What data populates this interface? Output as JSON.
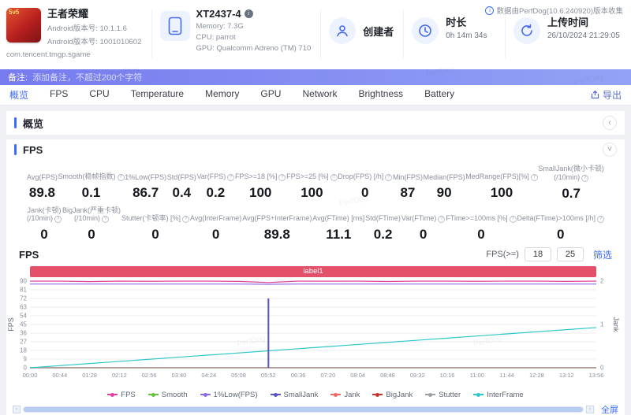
{
  "watermark": "PerfDog",
  "header": {
    "game": {
      "icon_text": "5v5",
      "name": "王者荣耀",
      "android_version": "Android版本号: 10.1.1.6",
      "android_build": "Android版本号: 1001010602",
      "package": "com.tencent.tmgp.sgame"
    },
    "device": {
      "model": "XT2437-4",
      "memory": "Memory: 7.3G",
      "cpu": "CPU: parrot",
      "gpu": "GPU: Qualcomm Adreno (TM) 710"
    },
    "creator": {
      "label": "创建者"
    },
    "duration": {
      "label": "时长",
      "value": "0h 14m 34s"
    },
    "upload": {
      "label": "上传时间",
      "value": "26/10/2024 21:29:05"
    },
    "collector_note": "数据由PerfDog(10.6.240920)版本收集"
  },
  "note_bar": {
    "label": "备注:",
    "placeholder": "添加备注，不超过200个字符"
  },
  "tabs": [
    "概览",
    "FPS",
    "CPU",
    "Temperature",
    "Memory",
    "GPU",
    "Network",
    "Brightness",
    "Battery"
  ],
  "active_tab": "概览",
  "export_label": "导出",
  "overview": {
    "title": "概览"
  },
  "fps_card": {
    "title": "FPS"
  },
  "metrics_row1": [
    {
      "label": "Avg(FPS)",
      "value": "89.8",
      "info": false
    },
    {
      "label": "Smooth(稳帧指数)",
      "value": "0.1",
      "info": true
    },
    {
      "label": "1%Low(FPS)",
      "value": "86.7",
      "info": false
    },
    {
      "label": "Std(FPS)",
      "value": "0.4",
      "info": false
    },
    {
      "label": "Var(FPS)",
      "value": "0.2",
      "info": true
    },
    {
      "label": "FPS>=18 [%]",
      "value": "100",
      "info": true
    },
    {
      "label": "FPS>=25 [%]",
      "value": "100",
      "info": true
    },
    {
      "label": "Drop(FPS) [/h]",
      "value": "0",
      "info": true
    },
    {
      "label": "Min(FPS)",
      "value": "87",
      "info": false
    },
    {
      "label": "Median(FPS)",
      "value": "90",
      "info": false
    },
    {
      "label": "MedRange(FPS)[%]",
      "value": "100",
      "info": true
    },
    {
      "label": "SmallJank(微小卡顿)",
      "sublabel": "(/10min)",
      "value": "0.7",
      "info": true
    }
  ],
  "metrics_row2": [
    {
      "label": "Jank(卡顿)",
      "sublabel": "(/10min)",
      "value": "0",
      "info": true
    },
    {
      "label": "BigJank(严重卡顿)",
      "sublabel": "(/10min)",
      "value": "0",
      "info": true
    },
    {
      "label": "Stutter(卡顿率) [%]",
      "value": "0",
      "info": true
    },
    {
      "label": "Avg(InterFrame)",
      "value": "0",
      "info": false
    },
    {
      "label": "Avg(FPS+InterFrame)",
      "value": "89.8",
      "info": false
    },
    {
      "label": "Avg(FTime) [ms]",
      "value": "11.1",
      "info": false
    },
    {
      "label": "Std(FTime)",
      "value": "0.2",
      "info": false
    },
    {
      "label": "Var(FTime)",
      "value": "0",
      "info": true
    },
    {
      "label": "FTime>=100ms [%]",
      "value": "0",
      "info": true
    },
    {
      "label": "Delta(FTime)>100ms [/h]",
      "value": "0",
      "info": true
    }
  ],
  "chart": {
    "title": "FPS",
    "filter_label": "FPS(>=)",
    "filter_min": "18",
    "filter_max": "25",
    "filter_button": "筛选",
    "label_bar": "label1",
    "fullscreen": "全屏"
  },
  "chart_data": {
    "type": "line",
    "x_ticks": [
      "00:00",
      "00:44",
      "01:28",
      "02:12",
      "02:56",
      "03:40",
      "04:24",
      "05:08",
      "05:52",
      "06:36",
      "07:20",
      "08:04",
      "08:48",
      "09:32",
      "10:16",
      "11:00",
      "11:44",
      "12:28",
      "13:12",
      "13:56"
    ],
    "y_left": {
      "label": "FPS",
      "range": [
        0,
        90
      ],
      "ticks": [
        90,
        81,
        72,
        63,
        54,
        45,
        36,
        27,
        18,
        9,
        0
      ]
    },
    "y_right": {
      "label": "Jank",
      "range": [
        0,
        2
      ],
      "ticks": [
        2,
        1,
        0
      ]
    },
    "grid": true,
    "legend_position": "bottom",
    "series": [
      {
        "name": "Smooth",
        "axis": "left",
        "color": "#67c23a",
        "values": [
          0,
          0,
          0,
          0,
          0,
          0,
          0,
          0,
          0,
          0,
          0,
          0,
          0,
          0,
          0,
          0,
          0,
          0,
          0,
          0
        ]
      },
      {
        "name": "Jank",
        "axis": "right",
        "color": "#ee6666",
        "values": [
          0,
          0,
          0,
          0,
          0,
          0,
          0,
          0,
          0,
          0,
          0,
          0,
          0,
          0,
          0,
          0,
          0,
          0,
          0,
          0
        ]
      },
      {
        "name": "BigJank",
        "axis": "right",
        "color": "#c23531",
        "values": [
          0,
          0,
          0,
          0,
          0,
          0,
          0,
          0,
          0,
          0,
          0,
          0,
          0,
          0,
          0,
          0,
          0,
          0,
          0,
          0
        ]
      },
      {
        "name": "Stutter",
        "axis": "left",
        "color": "#9aa0a6",
        "values": [
          0,
          0,
          0,
          0,
          0,
          0,
          0,
          0,
          0,
          0,
          0,
          0,
          0,
          0,
          0,
          0,
          0,
          0,
          0,
          0
        ]
      },
      {
        "name": "InterFrame",
        "axis": "left",
        "color": "#2ec7c9",
        "values": [
          0,
          2.2,
          4.4,
          6.6,
          8.8,
          11,
          13.2,
          15.4,
          17.6,
          19.8,
          22,
          24.2,
          26.4,
          28.6,
          30.8,
          33,
          35.2,
          37.4,
          39.6,
          41.8
        ]
      },
      {
        "name": "1%Low(FPS)",
        "axis": "left",
        "color": "#8d6ae8",
        "values": [
          87,
          87,
          87,
          87,
          87,
          87,
          87,
          87,
          86.7,
          87,
          87,
          87,
          87,
          87,
          87,
          87,
          87,
          87,
          87,
          87
        ]
      },
      {
        "name": "SmallJank",
        "type": "spike",
        "axis": "right",
        "color": "#5a51c7",
        "x_index": 8,
        "value": 1.6
      },
      {
        "name": "FPS",
        "axis": "left",
        "color": "#e0409f",
        "values": [
          90,
          90,
          89.5,
          90,
          89.8,
          90,
          90,
          89.7,
          88.5,
          90,
          89.9,
          90,
          89.6,
          90,
          90,
          89.8,
          90,
          90,
          89.7,
          90
        ]
      }
    ],
    "legend": [
      {
        "name": "FPS",
        "color": "#e0409f"
      },
      {
        "name": "Smooth",
        "color": "#67c23a"
      },
      {
        "name": "1%Low(FPS)",
        "color": "#8d6ae8"
      },
      {
        "name": "SmallJank",
        "color": "#5a51c7"
      },
      {
        "name": "Jank",
        "color": "#ee6666"
      },
      {
        "name": "BigJank",
        "color": "#c23531"
      },
      {
        "name": "Stutter",
        "color": "#9aa0a6"
      },
      {
        "name": "InterFrame",
        "color": "#2ec7c9"
      }
    ]
  }
}
